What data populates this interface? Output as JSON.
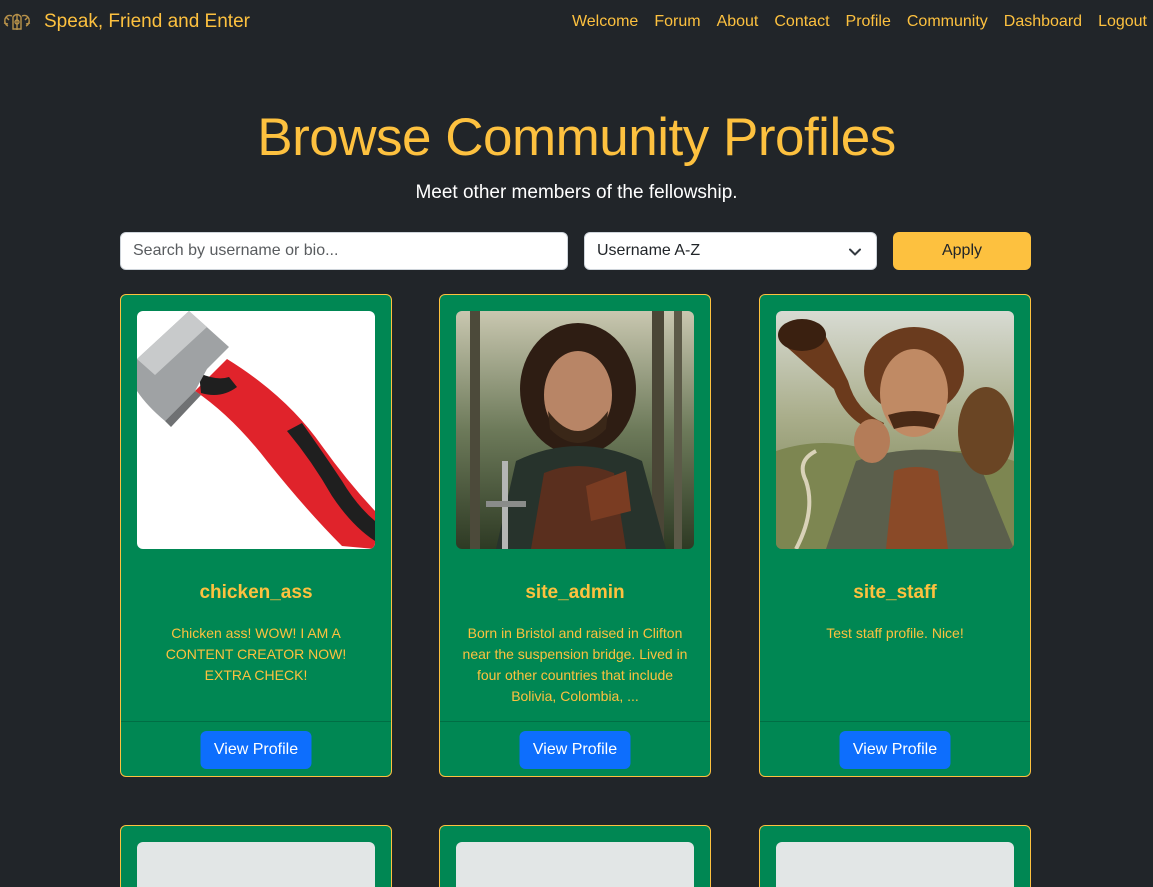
{
  "brand": {
    "name": "Speak, Friend and Enter"
  },
  "nav": [
    "Welcome",
    "Forum",
    "About",
    "Contact",
    "Profile",
    "Community",
    "Dashboard",
    "Logout"
  ],
  "header": {
    "title": "Browse Community Profiles",
    "subtitle": "Meet other members of the fellowship."
  },
  "filters": {
    "search_placeholder": "Search by username or bio...",
    "search_value": "",
    "sort_selected": "Username A-Z",
    "apply_label": "Apply"
  },
  "profiles": [
    {
      "username": "chicken_ass",
      "bio": "Chicken ass! WOW! I AM A CONTENT CREATOR NOW! EXTRA CHECK!",
      "image": "red-handled-axe",
      "button": "View Profile"
    },
    {
      "username": "site_admin",
      "bio": "Born in Bristol and raised in Clifton near the suspension bridge. Lived in four other countries that include Bolivia, Colombia, ...",
      "image": "ranger-with-sword",
      "button": "View Profile"
    },
    {
      "username": "site_staff",
      "bio": "Test staff profile. Nice!",
      "image": "man-with-pipe",
      "button": "View Profile"
    }
  ],
  "colors": {
    "background": "#212529",
    "accent": "#fdc13f",
    "card": "#008753",
    "button": "#0d6efd"
  }
}
